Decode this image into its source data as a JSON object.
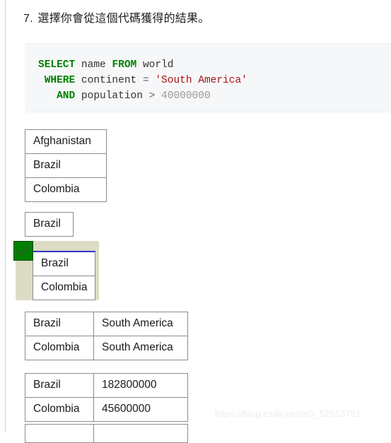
{
  "question": {
    "number": "7.",
    "text": "選擇你會從這個代碼獲得的結果。"
  },
  "code": {
    "language": "sql",
    "lines": [
      {
        "tokens": [
          {
            "t": "SELECT",
            "k": "kw"
          },
          {
            "t": " name ",
            "k": "pln"
          },
          {
            "t": "FROM",
            "k": "kw"
          },
          {
            "t": " world",
            "k": "pln"
          }
        ]
      },
      {
        "tokens": [
          {
            "t": " ",
            "k": "pln"
          },
          {
            "t": "WHERE",
            "k": "kw"
          },
          {
            "t": " continent ",
            "k": "pln"
          },
          {
            "t": "=",
            "k": "op"
          },
          {
            "t": " ",
            "k": "pln"
          },
          {
            "t": "'South America'",
            "k": "str"
          }
        ]
      },
      {
        "tokens": [
          {
            "t": "   ",
            "k": "pln"
          },
          {
            "t": "AND",
            "k": "kw"
          },
          {
            "t": " population ",
            "k": "pln"
          },
          {
            "t": ">",
            "k": "op"
          },
          {
            "t": " ",
            "k": "pln"
          },
          {
            "t": "40000000",
            "k": "num"
          }
        ]
      }
    ],
    "plain": "SELECT name FROM world\n WHERE continent = 'South America'\n   AND population > 40000000",
    "colors": {
      "keyword": "#008000",
      "string": "#a31515",
      "number": "#9a9a9a",
      "background": "#f6f7f9"
    }
  },
  "options": [
    {
      "id": "option-1",
      "selected": false,
      "columns": 1,
      "rows": [
        [
          "Afghanistan"
        ],
        [
          "Brazil"
        ],
        [
          "Colombia"
        ]
      ]
    },
    {
      "id": "option-2",
      "selected": false,
      "columns": 1,
      "rows": [
        [
          "Brazil"
        ]
      ]
    },
    {
      "id": "option-3",
      "selected": true,
      "columns": 1,
      "rows": [
        [
          "Brazil"
        ],
        [
          "Colombia"
        ]
      ]
    },
    {
      "id": "option-4",
      "selected": false,
      "columns": 2,
      "rows": [
        [
          "Brazil",
          "South America"
        ],
        [
          "Colombia",
          "South America"
        ]
      ]
    },
    {
      "id": "option-5",
      "selected": false,
      "columns": 2,
      "rows": [
        [
          "Brazil",
          "182800000"
        ],
        [
          "Colombia",
          "45600000"
        ]
      ]
    },
    {
      "id": "option-6",
      "selected": false,
      "columns": 2,
      "rows": [
        [
          "",
          ""
        ]
      ]
    }
  ],
  "selection": {
    "badge_icon": "check-icon",
    "badge_color": "#008000",
    "highlight_color": "#dcdcc4",
    "accent_border_color": "#3333cc"
  },
  "watermark": {
    "text": "https://blog.csdn.net/m0_52513791"
  }
}
